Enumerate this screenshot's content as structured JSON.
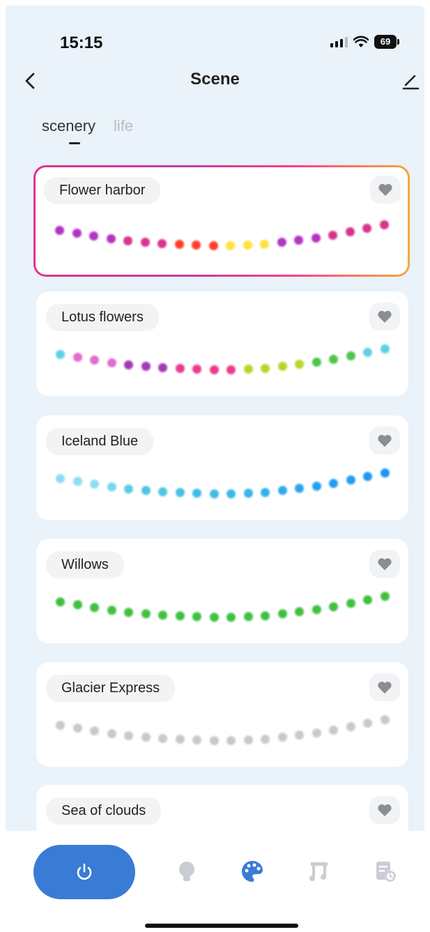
{
  "status_bar": {
    "time": "15:15",
    "battery": "69"
  },
  "header": {
    "title": "Scene"
  },
  "tabs": [
    {
      "label": "scenery",
      "active": true
    },
    {
      "label": "life",
      "active": false
    }
  ],
  "scenes": [
    {
      "name": "Flower harbor",
      "selected": true,
      "colors": [
        "#b433c2",
        "#b433c2",
        "#b433c2",
        "#b433c2",
        "#d8338e",
        "#d8338e",
        "#d8338e",
        "#ff3d2e",
        "#ff3d2e",
        "#ff3d2e",
        "#ffe23a",
        "#ffe23a",
        "#ffe23a",
        "#b433c2",
        "#b433c2",
        "#b433c2",
        "#d8338e",
        "#d8338e",
        "#d8338e",
        "#d8338e"
      ]
    },
    {
      "name": "Lotus flowers",
      "selected": false,
      "colors": [
        "#5fd0e6",
        "#e26bd0",
        "#e26bd0",
        "#e26bd0",
        "#a439b8",
        "#a439b8",
        "#a439b8",
        "#ea3b8f",
        "#ea3b8f",
        "#ea3b8f",
        "#ea3b8f",
        "#b8d62a",
        "#b8d62a",
        "#b8d62a",
        "#b8d62a",
        "#4ec44b",
        "#4ec44b",
        "#4ec44b",
        "#5fd0e6",
        "#5fd0e6"
      ]
    },
    {
      "name": "Iceland Blue",
      "selected": false,
      "colors": [
        "#8fdcf0",
        "#8fdcf0",
        "#8fdcf0",
        "#7ad6ec",
        "#5ccbe6",
        "#4dc4e6",
        "#4dc4e6",
        "#45c0e6",
        "#3fbce8",
        "#3fbce8",
        "#3ab8ea",
        "#36b4ec",
        "#32b0ee",
        "#2eaaf0",
        "#2aa4f2",
        "#26a0f2",
        "#229cf4",
        "#229cf4",
        "#1e98f4",
        "#1a94f6"
      ]
    },
    {
      "name": "Willows",
      "selected": false,
      "colors": [
        "#3fc13f",
        "#3fc13f",
        "#3fc13f",
        "#3fc13f",
        "#3fc13f",
        "#3fc13f",
        "#3fc13f",
        "#3fc13f",
        "#3fc13f",
        "#3fc13f",
        "#3fc13f",
        "#3fc13f",
        "#3fc13f",
        "#3fc13f",
        "#3fc13f",
        "#3fc13f",
        "#3fc13f",
        "#3fc13f",
        "#3fc13f",
        "#3fc13f"
      ]
    },
    {
      "name": "Glacier Express",
      "selected": false,
      "colors": [
        "#c9c9cc",
        "#c9c9cc",
        "#c9c9cc",
        "#c9c9cc",
        "#c9c9cc",
        "#c9c9cc",
        "#c9c9cc",
        "#c9c9cc",
        "#c9c9cc",
        "#c9c9cc",
        "#c9c9cc",
        "#c9c9cc",
        "#c9c9cc",
        "#c9c9cc",
        "#c9c9cc",
        "#c9c9cc",
        "#c9c9cc",
        "#c9c9cc",
        "#c9c9cc",
        "#c9c9cc"
      ]
    },
    {
      "name": "Sea of clouds",
      "selected": false,
      "colors": []
    }
  ],
  "bottom_nav": {
    "items": [
      "power-icon",
      "bulb-icon",
      "palette-icon",
      "music-icon",
      "schedule-icon"
    ],
    "active": "palette-icon",
    "accent": "#3a7bd5"
  }
}
